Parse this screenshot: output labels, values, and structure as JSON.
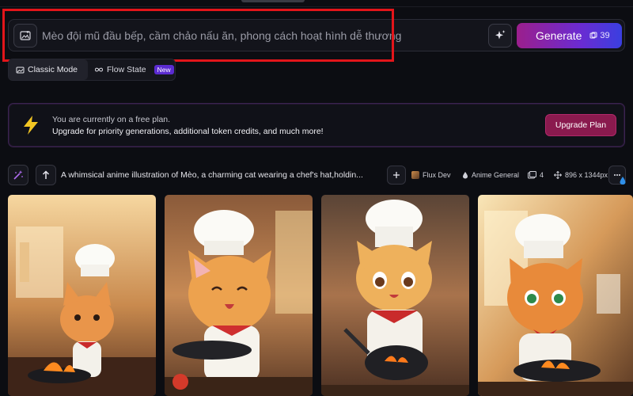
{
  "prompt": {
    "text": "Mèo đội mũ đầu bếp, cầm chảo nấu ăn, phong cách hoạt hình dễ thương",
    "generate_label": "Generate",
    "token_count": "39"
  },
  "modes": {
    "classic_label": "Classic Mode",
    "flow_label": "Flow State",
    "new_badge": "New"
  },
  "upgrade": {
    "title": "You are currently on a free plan.",
    "description": "Upgrade for priority generations, additional token credits, and much more!",
    "button_label": "Upgrade Plan"
  },
  "generation": {
    "prompt": "A whimsical anime illustration of Mèo, a charming cat wearing a chef's hat,holdin...",
    "model": "Flux Dev",
    "style": "Anime General",
    "image_count": "4",
    "dimensions": "896 x 1344px",
    "images": [
      {
        "icon": "cat-chef-image"
      },
      {
        "icon": "cat-chef-image"
      },
      {
        "icon": "cat-chef-image"
      },
      {
        "icon": "cat-chef-image"
      }
    ]
  },
  "colors": {
    "background": "#0c0d12",
    "generate_gradient_start": "#9b1f8c",
    "generate_gradient_end": "#3a3fe0",
    "upgrade_button": "#8a1a4e",
    "highlight": "#e3151a",
    "bolt": "#f3c623"
  }
}
